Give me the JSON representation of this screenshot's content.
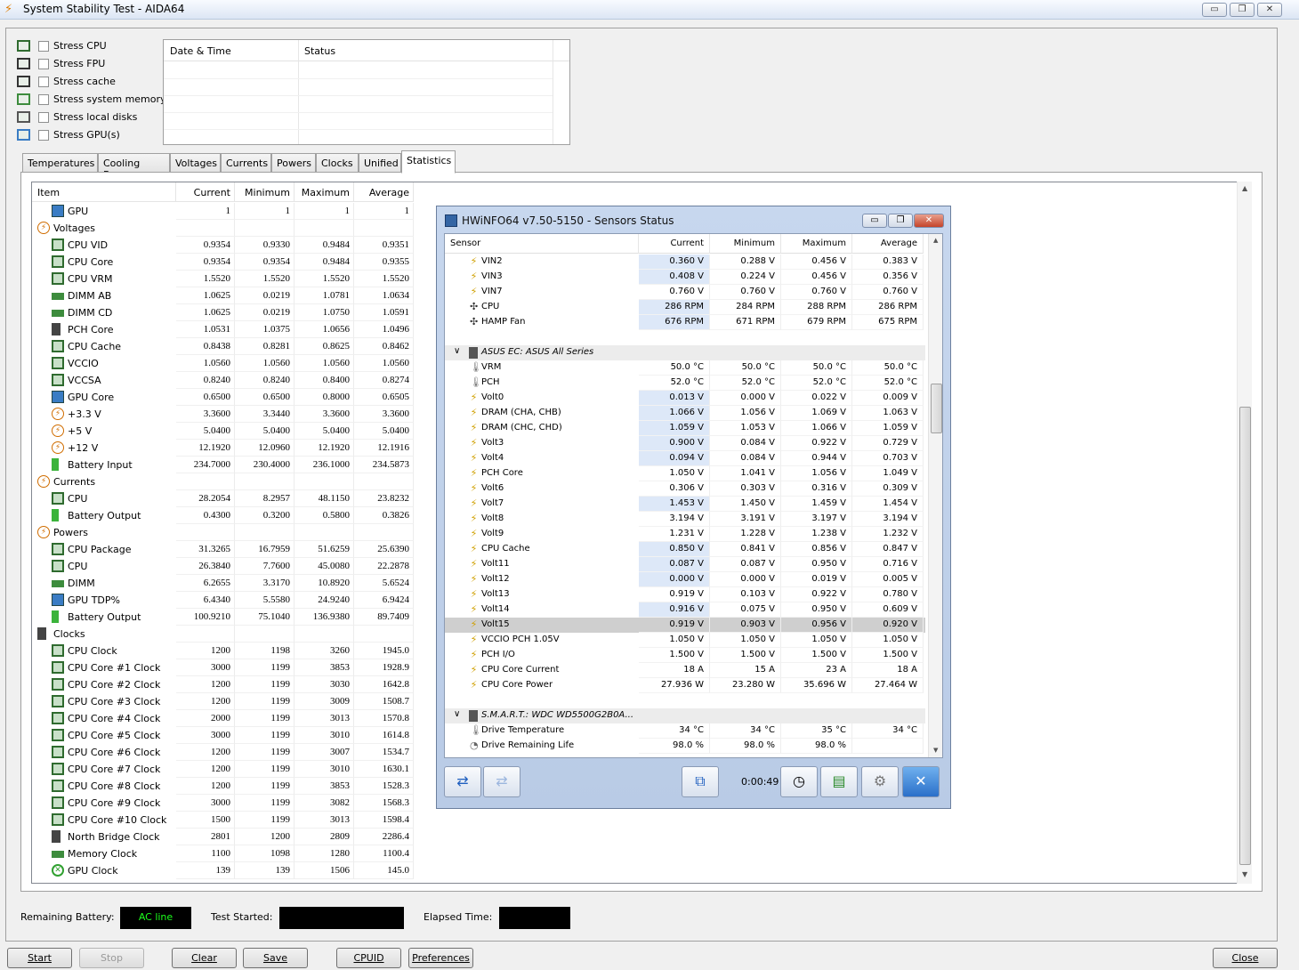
{
  "window": {
    "title": "System Stability Test - AIDA64",
    "minimize": "▭",
    "restore": "❐",
    "close": "✕"
  },
  "stress_options": [
    {
      "label": "Stress CPU",
      "icon": "cpu-chip-icon"
    },
    {
      "label": "Stress FPU",
      "icon": "fpu-icon"
    },
    {
      "label": "Stress cache",
      "icon": "cache-icon"
    },
    {
      "label": "Stress system memory",
      "icon": "memory-icon"
    },
    {
      "label": "Stress local disks",
      "icon": "disk-icon"
    },
    {
      "label": "Stress GPU(s)",
      "icon": "gpu-monitor-icon"
    }
  ],
  "log": {
    "col_datetime": "Date & Time",
    "col_status": "Status"
  },
  "tabs": [
    "Temperatures",
    "Cooling Fans",
    "Voltages",
    "Currents",
    "Powers",
    "Clocks",
    "Unified",
    "Statistics"
  ],
  "stats": {
    "headers": {
      "item": "Item",
      "current": "Current",
      "minimum": "Minimum",
      "maximum": "Maximum",
      "average": "Average"
    },
    "rows": [
      {
        "name": "GPU",
        "icon": "mon",
        "indent": 1,
        "cur": "1",
        "min": "1",
        "max": "1",
        "avg": "1"
      },
      {
        "name": "Voltages",
        "icon": "bolt",
        "indent": 0,
        "cur": "",
        "min": "",
        "max": "",
        "avg": ""
      },
      {
        "name": "CPU VID",
        "icon": "chip",
        "indent": 1,
        "cur": "0.9354",
        "min": "0.9330",
        "max": "0.9484",
        "avg": "0.9351"
      },
      {
        "name": "CPU Core",
        "icon": "chip",
        "indent": 1,
        "cur": "0.9354",
        "min": "0.9354",
        "max": "0.9484",
        "avg": "0.9355"
      },
      {
        "name": "CPU VRM",
        "icon": "chip",
        "indent": 1,
        "cur": "1.5520",
        "min": "1.5520",
        "max": "1.5520",
        "avg": "1.5520"
      },
      {
        "name": "DIMM AB",
        "icon": "mem",
        "indent": 1,
        "cur": "1.0625",
        "min": "0.0219",
        "max": "1.0781",
        "avg": "1.0634"
      },
      {
        "name": "DIMM CD",
        "icon": "mem",
        "indent": 1,
        "cur": "1.0625",
        "min": "0.0219",
        "max": "1.0750",
        "avg": "1.0591"
      },
      {
        "name": "PCH Core",
        "icon": "pch",
        "indent": 1,
        "cur": "1.0531",
        "min": "1.0375",
        "max": "1.0656",
        "avg": "1.0496"
      },
      {
        "name": "CPU Cache",
        "icon": "chip",
        "indent": 1,
        "cur": "0.8438",
        "min": "0.8281",
        "max": "0.8625",
        "avg": "0.8462"
      },
      {
        "name": "VCCIO",
        "icon": "chip",
        "indent": 1,
        "cur": "1.0560",
        "min": "1.0560",
        "max": "1.0560",
        "avg": "1.0560"
      },
      {
        "name": "VCCSA",
        "icon": "chip",
        "indent": 1,
        "cur": "0.8240",
        "min": "0.8240",
        "max": "0.8400",
        "avg": "0.8274"
      },
      {
        "name": "GPU Core",
        "icon": "mon",
        "indent": 1,
        "cur": "0.6500",
        "min": "0.6500",
        "max": "0.8000",
        "avg": "0.6505"
      },
      {
        "name": "+3.3 V",
        "icon": "bolt",
        "indent": 1,
        "cur": "3.3600",
        "min": "3.3440",
        "max": "3.3600",
        "avg": "3.3600"
      },
      {
        "name": "+5 V",
        "icon": "bolt",
        "indent": 1,
        "cur": "5.0400",
        "min": "5.0400",
        "max": "5.0400",
        "avg": "5.0400"
      },
      {
        "name": "+12 V",
        "icon": "bolt",
        "indent": 1,
        "cur": "12.1920",
        "min": "12.0960",
        "max": "12.1920",
        "avg": "12.1916"
      },
      {
        "name": "Battery Input",
        "icon": "bat",
        "indent": 1,
        "cur": "234.7000",
        "min": "230.4000",
        "max": "236.1000",
        "avg": "234.5873"
      },
      {
        "name": "Currents",
        "icon": "bolt",
        "indent": 0,
        "cur": "",
        "min": "",
        "max": "",
        "avg": ""
      },
      {
        "name": "CPU",
        "icon": "chip",
        "indent": 1,
        "cur": "28.2054",
        "min": "8.2957",
        "max": "48.1150",
        "avg": "23.8232"
      },
      {
        "name": "Battery Output",
        "icon": "bat",
        "indent": 1,
        "cur": "0.4300",
        "min": "0.3200",
        "max": "0.5800",
        "avg": "0.3826"
      },
      {
        "name": "Powers",
        "icon": "bolt",
        "indent": 0,
        "cur": "",
        "min": "",
        "max": "",
        "avg": ""
      },
      {
        "name": "CPU Package",
        "icon": "chip",
        "indent": 1,
        "cur": "31.3265",
        "min": "16.7959",
        "max": "51.6259",
        "avg": "25.6390"
      },
      {
        "name": "CPU",
        "icon": "chip",
        "indent": 1,
        "cur": "26.3840",
        "min": "7.7600",
        "max": "45.0080",
        "avg": "22.2878"
      },
      {
        "name": "DIMM",
        "icon": "mem",
        "indent": 1,
        "cur": "6.2655",
        "min": "3.3170",
        "max": "10.8920",
        "avg": "5.6524"
      },
      {
        "name": "GPU TDP%",
        "icon": "mon",
        "indent": 1,
        "cur": "6.4340",
        "min": "5.5580",
        "max": "24.9240",
        "avg": "6.9424"
      },
      {
        "name": "Battery Output",
        "icon": "bat",
        "indent": 1,
        "cur": "100.9210",
        "min": "75.1040",
        "max": "136.9380",
        "avg": "89.7409"
      },
      {
        "name": "Clocks",
        "icon": "pch",
        "indent": 0,
        "cur": "",
        "min": "",
        "max": "",
        "avg": ""
      },
      {
        "name": "CPU Clock",
        "icon": "chip",
        "indent": 1,
        "cur": "1200",
        "min": "1198",
        "max": "3260",
        "avg": "1945.0"
      },
      {
        "name": "CPU Core #1 Clock",
        "icon": "chip",
        "indent": 1,
        "cur": "3000",
        "min": "1199",
        "max": "3853",
        "avg": "1928.9"
      },
      {
        "name": "CPU Core #2 Clock",
        "icon": "chip",
        "indent": 1,
        "cur": "1200",
        "min": "1199",
        "max": "3030",
        "avg": "1642.8"
      },
      {
        "name": "CPU Core #3 Clock",
        "icon": "chip",
        "indent": 1,
        "cur": "1200",
        "min": "1199",
        "max": "3009",
        "avg": "1508.7"
      },
      {
        "name": "CPU Core #4 Clock",
        "icon": "chip",
        "indent": 1,
        "cur": "2000",
        "min": "1199",
        "max": "3013",
        "avg": "1570.8"
      },
      {
        "name": "CPU Core #5 Clock",
        "icon": "chip",
        "indent": 1,
        "cur": "3000",
        "min": "1199",
        "max": "3010",
        "avg": "1614.8"
      },
      {
        "name": "CPU Core #6 Clock",
        "icon": "chip",
        "indent": 1,
        "cur": "1200",
        "min": "1199",
        "max": "3007",
        "avg": "1534.7"
      },
      {
        "name": "CPU Core #7 Clock",
        "icon": "chip",
        "indent": 1,
        "cur": "1200",
        "min": "1199",
        "max": "3010",
        "avg": "1630.1"
      },
      {
        "name": "CPU Core #8 Clock",
        "icon": "chip",
        "indent": 1,
        "cur": "1200",
        "min": "1199",
        "max": "3853",
        "avg": "1528.3"
      },
      {
        "name": "CPU Core #9 Clock",
        "icon": "chip",
        "indent": 1,
        "cur": "3000",
        "min": "1199",
        "max": "3082",
        "avg": "1568.3"
      },
      {
        "name": "CPU Core #10 Clock",
        "icon": "chip",
        "indent": 1,
        "cur": "1500",
        "min": "1199",
        "max": "3013",
        "avg": "1598.4"
      },
      {
        "name": "North Bridge Clock",
        "icon": "pch",
        "indent": 1,
        "cur": "2801",
        "min": "1200",
        "max": "2809",
        "avg": "2286.4"
      },
      {
        "name": "Memory Clock",
        "icon": "mem",
        "indent": 1,
        "cur": "1100",
        "min": "1098",
        "max": "1280",
        "avg": "1100.4"
      },
      {
        "name": "GPU Clock",
        "icon": "xbox",
        "indent": 1,
        "cur": "139",
        "min": "139",
        "max": "1506",
        "avg": "145.0"
      }
    ]
  },
  "status": {
    "remaining_battery_label": "Remaining Battery:",
    "remaining_battery_value": "AC line",
    "test_started_label": "Test Started:",
    "elapsed_label": "Elapsed Time:"
  },
  "buttons": {
    "start": "Start",
    "stop": "Stop",
    "clear": "Clear",
    "save": "Save",
    "cpuid": "CPUID",
    "preferences": "Preferences",
    "close": "Close"
  },
  "hwinfo": {
    "title": "HWiNFO64 v7.50-5150 - Sensors Status",
    "headers": {
      "sensor": "Sensor",
      "current": "Current",
      "minimum": "Minimum",
      "maximum": "Maximum",
      "average": "Average"
    },
    "timer": "0:00:49",
    "rows": [
      {
        "type": "row",
        "name": "VIN2",
        "icon": "volt",
        "cur": "0.360 V",
        "min": "0.288 V",
        "max": "0.456 V",
        "avg": "0.383 V",
        "hl": true
      },
      {
        "type": "row",
        "name": "VIN3",
        "icon": "volt",
        "cur": "0.408 V",
        "min": "0.224 V",
        "max": "0.456 V",
        "avg": "0.356 V",
        "hl": true
      },
      {
        "type": "row",
        "name": "VIN7",
        "icon": "volt",
        "cur": "0.760 V",
        "min": "0.760 V",
        "max": "0.760 V",
        "avg": "0.760 V",
        "hl": false
      },
      {
        "type": "row",
        "name": "CPU",
        "icon": "fan",
        "cur": "286 RPM",
        "min": "284 RPM",
        "max": "288 RPM",
        "avg": "286 RPM",
        "hl": true
      },
      {
        "type": "row",
        "name": "HAMP Fan",
        "icon": "fan",
        "cur": "676 RPM",
        "min": "671 RPM",
        "max": "679 RPM",
        "avg": "675 RPM",
        "hl": true
      },
      {
        "type": "blank"
      },
      {
        "type": "group",
        "name": "ASUS EC: ASUS All Series"
      },
      {
        "type": "row",
        "name": "VRM",
        "icon": "temp",
        "cur": "50.0 °C",
        "min": "50.0 °C",
        "max": "50.0 °C",
        "avg": "50.0 °C",
        "hl": false
      },
      {
        "type": "row",
        "name": "PCH",
        "icon": "temp",
        "cur": "52.0 °C",
        "min": "52.0 °C",
        "max": "52.0 °C",
        "avg": "52.0 °C",
        "hl": false
      },
      {
        "type": "row",
        "name": "Volt0",
        "icon": "volt",
        "cur": "0.013 V",
        "min": "0.000 V",
        "max": "0.022 V",
        "avg": "0.009 V",
        "hl": true
      },
      {
        "type": "row",
        "name": "DRAM (CHA, CHB)",
        "icon": "volt",
        "cur": "1.066 V",
        "min": "1.056 V",
        "max": "1.069 V",
        "avg": "1.063 V",
        "hl": true
      },
      {
        "type": "row",
        "name": "DRAM (CHC, CHD)",
        "icon": "volt",
        "cur": "1.059 V",
        "min": "1.053 V",
        "max": "1.066 V",
        "avg": "1.059 V",
        "hl": true
      },
      {
        "type": "row",
        "name": "Volt3",
        "icon": "volt",
        "cur": "0.900 V",
        "min": "0.084 V",
        "max": "0.922 V",
        "avg": "0.729 V",
        "hl": true
      },
      {
        "type": "row",
        "name": "Volt4",
        "icon": "volt",
        "cur": "0.094 V",
        "min": "0.084 V",
        "max": "0.944 V",
        "avg": "0.703 V",
        "hl": true
      },
      {
        "type": "row",
        "name": "PCH Core",
        "icon": "volt",
        "cur": "1.050 V",
        "min": "1.041 V",
        "max": "1.056 V",
        "avg": "1.049 V",
        "hl": false
      },
      {
        "type": "row",
        "name": "Volt6",
        "icon": "volt",
        "cur": "0.306 V",
        "min": "0.303 V",
        "max": "0.316 V",
        "avg": "0.309 V",
        "hl": false
      },
      {
        "type": "row",
        "name": "Volt7",
        "icon": "volt",
        "cur": "1.453 V",
        "min": "1.450 V",
        "max": "1.459 V",
        "avg": "1.454 V",
        "hl": true
      },
      {
        "type": "row",
        "name": "Volt8",
        "icon": "volt",
        "cur": "3.194 V",
        "min": "3.191 V",
        "max": "3.197 V",
        "avg": "3.194 V",
        "hl": false
      },
      {
        "type": "row",
        "name": "Volt9",
        "icon": "volt",
        "cur": "1.231 V",
        "min": "1.228 V",
        "max": "1.238 V",
        "avg": "1.232 V",
        "hl": false
      },
      {
        "type": "row",
        "name": "CPU Cache",
        "icon": "volt",
        "cur": "0.850 V",
        "min": "0.841 V",
        "max": "0.856 V",
        "avg": "0.847 V",
        "hl": true
      },
      {
        "type": "row",
        "name": "Volt11",
        "icon": "volt",
        "cur": "0.087 V",
        "min": "0.087 V",
        "max": "0.950 V",
        "avg": "0.716 V",
        "hl": true
      },
      {
        "type": "row",
        "name": "Volt12",
        "icon": "volt",
        "cur": "0.000 V",
        "min": "0.000 V",
        "max": "0.019 V",
        "avg": "0.005 V",
        "hl": true
      },
      {
        "type": "row",
        "name": "Volt13",
        "icon": "volt",
        "cur": "0.919 V",
        "min": "0.103 V",
        "max": "0.922 V",
        "avg": "0.780 V",
        "hl": false
      },
      {
        "type": "row",
        "name": "Volt14",
        "icon": "volt",
        "cur": "0.916 V",
        "min": "0.075 V",
        "max": "0.950 V",
        "avg": "0.609 V",
        "hl": true
      },
      {
        "type": "row",
        "name": "Volt15",
        "icon": "volt",
        "cur": "0.919 V",
        "min": "0.903 V",
        "max": "0.956 V",
        "avg": "0.920 V",
        "hl": false,
        "sel": true
      },
      {
        "type": "row",
        "name": "VCCIO PCH 1.05V",
        "icon": "volt",
        "cur": "1.050 V",
        "min": "1.050 V",
        "max": "1.050 V",
        "avg": "1.050 V",
        "hl": false
      },
      {
        "type": "row",
        "name": "PCH I/O",
        "icon": "volt",
        "cur": "1.500 V",
        "min": "1.500 V",
        "max": "1.500 V",
        "avg": "1.500 V",
        "hl": false
      },
      {
        "type": "row",
        "name": "CPU Core Current",
        "icon": "volt",
        "cur": "18 A",
        "min": "15 A",
        "max": "23 A",
        "avg": "18 A",
        "hl": false
      },
      {
        "type": "row",
        "name": "CPU Core Power",
        "icon": "volt",
        "cur": "27.936 W",
        "min": "23.280 W",
        "max": "35.696 W",
        "avg": "27.464 W",
        "hl": false
      },
      {
        "type": "blank"
      },
      {
        "type": "group",
        "name": "S.M.A.R.T.: WDC WD5500G2B0A..."
      },
      {
        "type": "row",
        "name": "Drive Temperature",
        "icon": "temp",
        "cur": "34 °C",
        "min": "34 °C",
        "max": "35 °C",
        "avg": "34 °C",
        "hl": false
      },
      {
        "type": "row",
        "name": "Drive Remaining Life",
        "icon": "life",
        "cur": "98.0 %",
        "min": "98.0 %",
        "max": "98.0 %",
        "avg": "",
        "hl": false
      }
    ]
  }
}
